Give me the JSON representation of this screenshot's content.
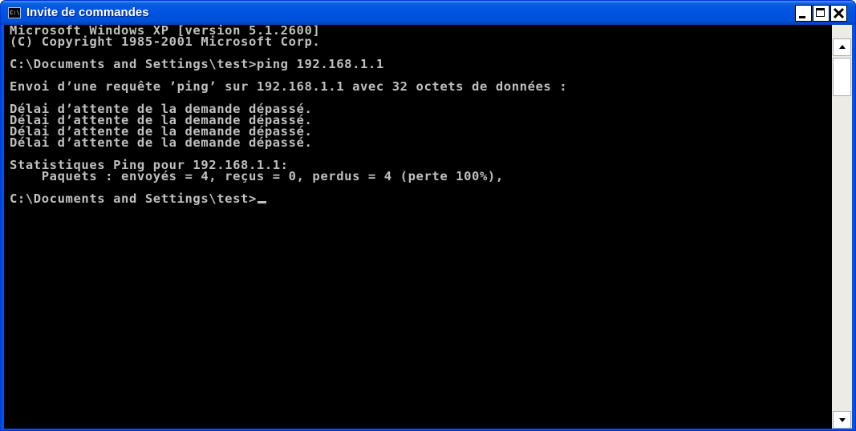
{
  "window": {
    "title": "Invite de commandes",
    "icon_text": "C:\\"
  },
  "console": {
    "lines": [
      "Microsoft Windows XP [version 5.1.2600]",
      "(C) Copyright 1985-2001 Microsoft Corp.",
      "",
      "C:\\Documents and Settings\\test>ping 192.168.1.1",
      "",
      "Envoi d’une requête ’ping’ sur 192.168.1.1 avec 32 octets de données :",
      "",
      "Délai d’attente de la demande dépassé.",
      "Délai d’attente de la demande dépassé.",
      "Délai d’attente de la demande dépassé.",
      "Délai d’attente de la demande dépassé.",
      "",
      "Statistiques Ping pour 192.168.1.1:",
      "    Paquets : envoyés = 4, reçus = 0, perdus = 4 (perte 100%),",
      "",
      "C:\\Documents and Settings\\test>"
    ]
  },
  "colors": {
    "titlebar": "#0054e3",
    "console_bg": "#000000",
    "console_fg": "#c0c0c0"
  }
}
